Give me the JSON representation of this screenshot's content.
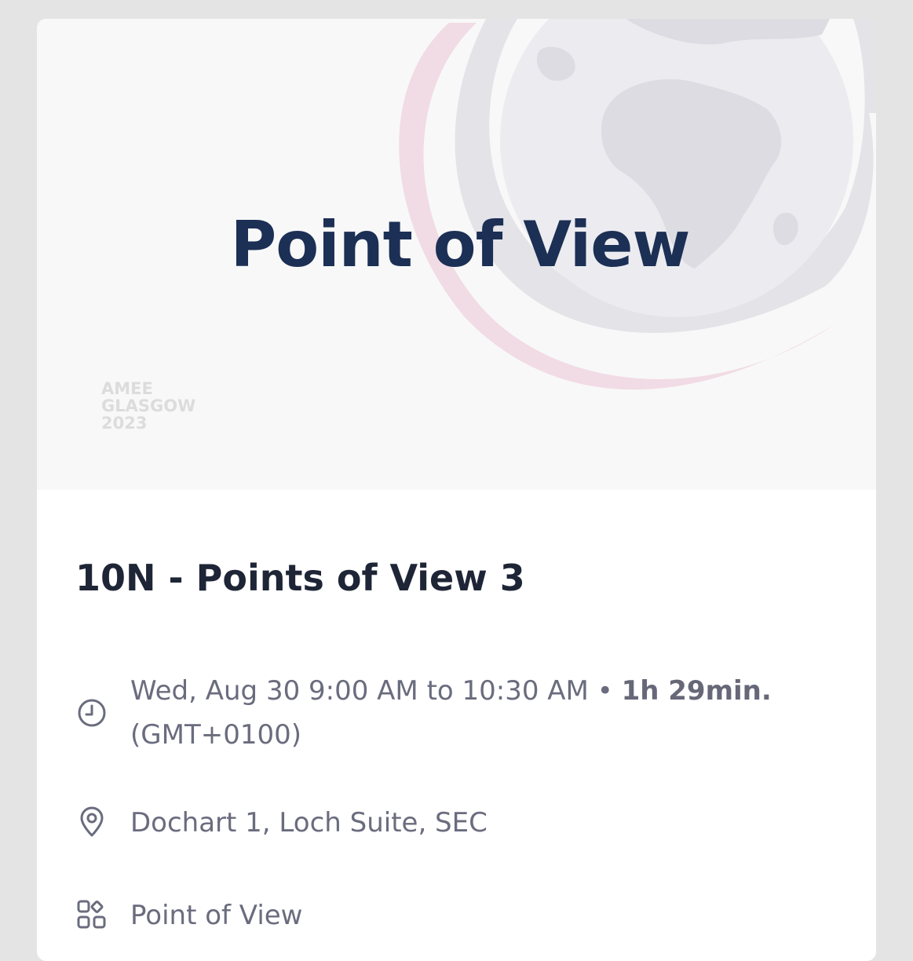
{
  "banner": {
    "title": "Point of View",
    "logo_lines": [
      "AMEE",
      "GLASGOW",
      "2023"
    ]
  },
  "session": {
    "title": "10N - Points of View 3",
    "time": {
      "range": "Wed, Aug 30 9:00 AM to 10:30 AM",
      "separator": " • ",
      "duration": "1h 29min.",
      "timezone": "(GMT+0100)"
    },
    "location": "Dochart 1, Loch Suite, SEC",
    "category": "Point of View"
  },
  "icons": {
    "time": "clock-icon",
    "location": "map-pin-icon",
    "category": "grid-icon"
  },
  "colors": {
    "page_background": "#e4e4e4",
    "card_background": "#ffffff",
    "banner_background": "#f8f8f8",
    "banner_title": "#1c2f55",
    "session_title": "#1e2536",
    "meta_text": "#6a6c7e",
    "globe": "#e1e1e6",
    "swoosh": "#f1dbe4"
  }
}
